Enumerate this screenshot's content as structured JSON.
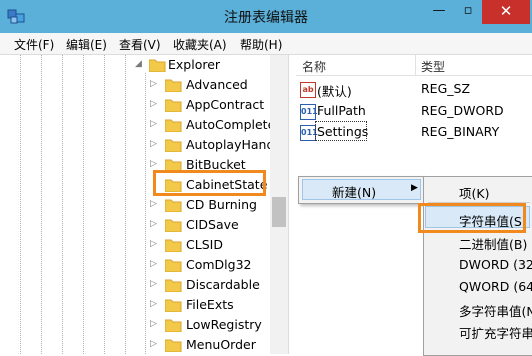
{
  "window": {
    "title": "注册表编辑器",
    "minimize": "—",
    "maximize": "▫",
    "close": "✕"
  },
  "menubar": [
    "文件(F)",
    "编辑(E)",
    "查看(V)",
    "收藏夹(A)",
    "帮助(H)"
  ],
  "tree": {
    "parent": "Explorer",
    "items": [
      "Advanced",
      "AppContract",
      "AutoComplete",
      "AutoplayHandl",
      "BitBucket",
      "CabinetState",
      "CD Burning",
      "CIDSave",
      "CLSID",
      "ComDlg32",
      "Discardable",
      "FileExts",
      "LowRegistry",
      "MenuOrder"
    ],
    "selected": "CabinetState"
  },
  "values": {
    "headers": {
      "name": "名称",
      "type": "类型"
    },
    "rows": [
      {
        "icon": "string-value-icon",
        "glyph": "ab",
        "name": "(默认)",
        "type": "REG_SZ"
      },
      {
        "icon": "binary-value-icon",
        "glyph": "011",
        "name": "FullPath",
        "type": "REG_DWORD"
      },
      {
        "icon": "binary-value-icon",
        "glyph": "011",
        "name": "Settings",
        "type": "REG_BINARY"
      }
    ]
  },
  "context_menu": {
    "label": "新建(N)",
    "arrow": "▶"
  },
  "submenu": {
    "items": [
      "项(K)",
      "字符串值(S)",
      "二进制值(B)",
      "DWORD (32",
      "QWORD (64",
      "多字符串值(N",
      "可扩充字符串"
    ],
    "highlighted": "字符串值(S)"
  },
  "colors": {
    "titlebar": "#5ab0d9",
    "highlight_box": "#f18a1e",
    "close": "#c7302b"
  }
}
